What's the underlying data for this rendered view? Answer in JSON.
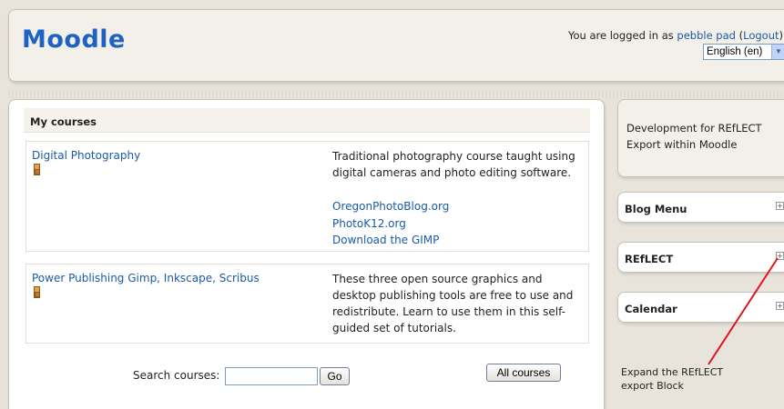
{
  "header": {
    "logo": "Moodle",
    "login_prefix": "You are logged in as ",
    "user_name": "pebble pad",
    "logout_open": " (",
    "logout_label": "Logout",
    "logout_close": ")",
    "language": "English (en)"
  },
  "my_courses": {
    "title": "My courses",
    "courses": [
      {
        "name": "Digital Photography",
        "description": "Traditional photography course taught using digital cameras and photo editing software.",
        "links": [
          "OregonPhotoBlog.org",
          "PhotoK12.org",
          "Download the GIMP"
        ]
      },
      {
        "name": "Power Publishing Gimp, Inkscape, Scribus",
        "description": "These three open source graphics and desktop publishing tools are free to use and redistribute. Learn to use them in this self-guided set of tutorials."
      }
    ]
  },
  "search": {
    "label": "Search courses:",
    "value": "",
    "go_label": "Go",
    "all_courses_label": "All courses"
  },
  "sidebar": {
    "site_description": "Development for REfLECT Export within Moodle",
    "blocks": [
      {
        "title": "Blog Menu"
      },
      {
        "title": "REfLECT"
      },
      {
        "title": "Calendar"
      }
    ],
    "annotation": "Expand the REfLECT export Block"
  },
  "colors": {
    "logo": "#1e63c4",
    "link": "#1a5aa6",
    "annotation_arrow": "#e0141a"
  }
}
